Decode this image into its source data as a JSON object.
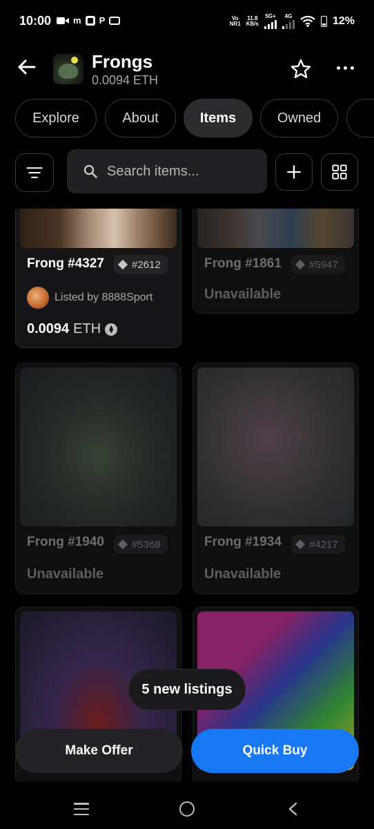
{
  "status_bar": {
    "time": "10:00",
    "left_icons": [
      "video-icon",
      "m-icon",
      "app-icon",
      "p-icon",
      "cast-icon"
    ],
    "net_top": "Vo",
    "net_bottom": "NR1",
    "speed_top": "11.8",
    "speed_bottom": "KB/s",
    "sig1": "5G+",
    "sig2": "4G",
    "battery": "12%"
  },
  "header": {
    "title": "Frongs",
    "floor_price": "0.0094 ETH"
  },
  "tabs": [
    {
      "label": "Explore",
      "active": false
    },
    {
      "label": "About",
      "active": false
    },
    {
      "label": "Items",
      "active": true
    },
    {
      "label": "Owned",
      "active": false
    }
  ],
  "search": {
    "placeholder": "Search items..."
  },
  "items": [
    {
      "name": "Frong #4327",
      "rank": "#2612",
      "seller": "Listed by 8888Sport",
      "price_value": "0.0094",
      "price_unit": "ETH"
    },
    {
      "name": "Frong #1861",
      "rank": "#5947",
      "status": "Unavailable"
    },
    {
      "name": "Frong #1940",
      "rank": "#5368",
      "status": "Unavailable"
    },
    {
      "name": "Frong #1934",
      "rank": "#4217",
      "status": "Unavailable"
    }
  ],
  "toast": "5 new listings",
  "actions": {
    "make_offer": "Make Offer",
    "quick_buy": "Quick Buy"
  },
  "colors": {
    "accent": "#1877f2",
    "background": "#000000",
    "surface": "#212124"
  }
}
